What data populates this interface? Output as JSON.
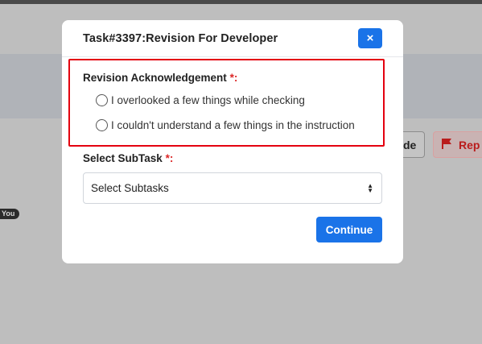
{
  "background": {
    "code_button_label": "de",
    "report_button_label": "Rep",
    "badge_text": "You"
  },
  "modal": {
    "title": "Task#3397:Revision For Developer",
    "close_icon": "×",
    "revision": {
      "label": "Revision Acknowledgement",
      "required_mark": "*:",
      "options": [
        {
          "label": "I overlooked a few things while checking",
          "selected": false
        },
        {
          "label": "I couldn't understand a few things in the instruction",
          "selected": false
        }
      ]
    },
    "subtask": {
      "label": "Select SubTask",
      "required_mark": "*:",
      "selected_value": "Select Subtasks"
    },
    "continue_label": "Continue"
  },
  "colors": {
    "primary": "#1a73e8",
    "highlight_border": "#e4000f",
    "required": "#dc2626",
    "overlay": "#bebebe"
  }
}
